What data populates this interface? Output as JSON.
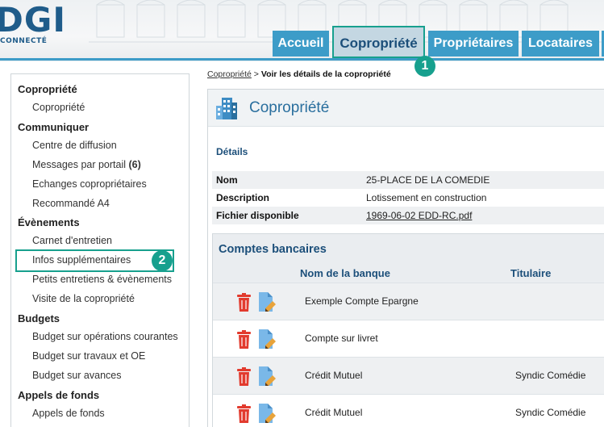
{
  "brand": {
    "logo_text": "DGI",
    "logo_subtitle": "CONNECTÉ",
    "accent_color": "#3d9cc8",
    "highlight_color": "#17a08e"
  },
  "nav": {
    "tabs": [
      "Accueil",
      "Copropriété",
      "Propriétaires",
      "Locataires"
    ],
    "active_tab": "Copropriété"
  },
  "callouts": [
    "1",
    "2"
  ],
  "sidebar": {
    "sections": [
      {
        "title": "Copropriété",
        "items": [
          "Copropriété"
        ]
      },
      {
        "title": "Communiquer",
        "items": [
          "Centre de diffusion",
          "Messages par portail",
          "Echanges copropriétaires",
          "Recommandé A4"
        ]
      },
      {
        "title": "Évènements",
        "items": [
          "Carnet d'entretien",
          "Infos supplémentaires",
          "Petits entretiens & évènements",
          "Visite de la copropriété"
        ]
      },
      {
        "title": "Budgets",
        "items": [
          "Budget sur opérations courantes",
          "Budget sur travaux et OE",
          "Budget sur avances"
        ]
      },
      {
        "title": "Appels de fonds",
        "items": [
          "Appels de fonds"
        ]
      }
    ],
    "messages_count": "(6)",
    "highlighted_item": "Infos supplémentaires"
  },
  "breadcrumb": {
    "link": "Copropriété",
    "separator": ">",
    "current": "Voir les détails de la copropriété"
  },
  "panel": {
    "title": "Copropriété",
    "icon": "building-icon",
    "details_label": "Détails",
    "details": [
      {
        "key": "Nom",
        "value": "25-PLACE DE LA COMEDIE"
      },
      {
        "key": "Description",
        "value": "Lotissement en construction"
      },
      {
        "key": "Fichier disponible",
        "value": "1969-06-02 EDD-RC.pdf"
      }
    ]
  },
  "bank_accounts": {
    "title": "Comptes bancaires",
    "columns": [
      "Nom de la banque",
      "Titulaire"
    ],
    "rows": [
      {
        "bank": "Exemple Compte Epargne",
        "holder": ""
      },
      {
        "bank": "Compte sur livret",
        "holder": ""
      },
      {
        "bank": "Crédit Mutuel",
        "holder": "Syndic Comédie"
      },
      {
        "bank": "Crédit Mutuel",
        "holder": "Syndic Comédie"
      }
    ],
    "row_icons": [
      "trash-icon",
      "edit-document-icon"
    ]
  }
}
